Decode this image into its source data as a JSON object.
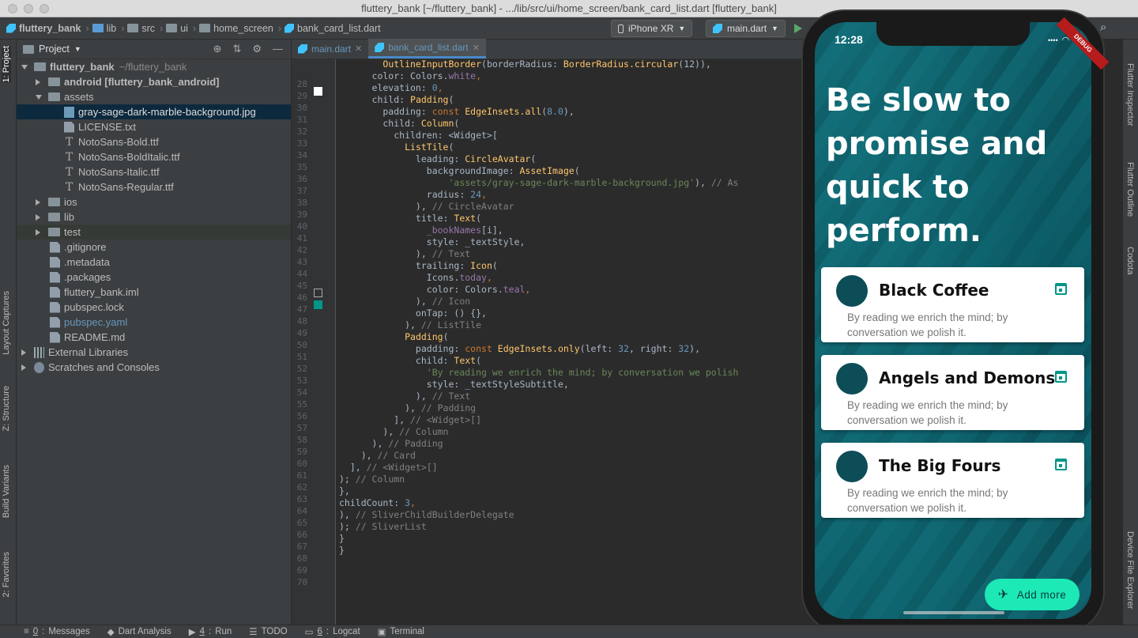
{
  "window": {
    "title": "fluttery_bank [~/fluttery_bank] - .../lib/src/ui/home_screen/bank_card_list.dart [fluttery_bank]"
  },
  "breadcrumbs": [
    "fluttery_bank",
    "lib",
    "src",
    "ui",
    "home_screen",
    "bank_card_list.dart"
  ],
  "toolbar": {
    "device": "iPhone XR",
    "run_config": "main.dart"
  },
  "project_panel": {
    "title": "Project",
    "tree": [
      {
        "label": "fluttery_bank",
        "suffix": "~/fluttery_bank",
        "icon": "folder-icon",
        "indent": 0,
        "arrow": "down",
        "bold": true
      },
      {
        "label": "android [fluttery_bank_android]",
        "icon": "folder-icon",
        "indent": 1,
        "arrow": "right",
        "bold": true
      },
      {
        "label": "assets",
        "icon": "folder-icon",
        "indent": 1,
        "arrow": "down"
      },
      {
        "label": "gray-sage-dark-marble-background.jpg",
        "icon": "image-file-icon",
        "indent": 2,
        "selected": true
      },
      {
        "label": "LICENSE.txt",
        "icon": "text-file-icon",
        "indent": 2
      },
      {
        "label": "NotoSans-Bold.ttf",
        "icon": "font-file-icon",
        "indent": 2
      },
      {
        "label": "NotoSans-BoldItalic.ttf",
        "icon": "font-file-icon",
        "indent": 2
      },
      {
        "label": "NotoSans-Italic.ttf",
        "icon": "font-file-icon",
        "indent": 2
      },
      {
        "label": "NotoSans-Regular.ttf",
        "icon": "font-file-icon",
        "indent": 2
      },
      {
        "label": "ios",
        "icon": "folder-icon",
        "indent": 1,
        "arrow": "right"
      },
      {
        "label": "lib",
        "icon": "folder-icon",
        "indent": 1,
        "arrow": "right"
      },
      {
        "label": "test",
        "icon": "folder-icon",
        "indent": 1,
        "arrow": "right",
        "highlight": true
      },
      {
        "label": ".gitignore",
        "icon": "text-file-icon",
        "indent": 1
      },
      {
        "label": ".metadata",
        "icon": "text-file-icon",
        "indent": 1
      },
      {
        "label": ".packages",
        "icon": "text-file-icon",
        "indent": 1
      },
      {
        "label": "fluttery_bank.iml",
        "icon": "text-file-icon",
        "indent": 1
      },
      {
        "label": "pubspec.lock",
        "icon": "text-file-icon",
        "indent": 1
      },
      {
        "label": "pubspec.yaml",
        "icon": "text-file-icon",
        "indent": 1,
        "blue": true
      },
      {
        "label": "README.md",
        "icon": "text-file-icon",
        "indent": 1
      },
      {
        "label": "External Libraries",
        "icon": "library-icon",
        "indent": 0,
        "arrow": "right"
      },
      {
        "label": "Scratches and Consoles",
        "icon": "scratch-icon",
        "indent": 0,
        "arrow": "right"
      }
    ]
  },
  "editor": {
    "tabs": [
      {
        "label": "main.dart",
        "active": false
      },
      {
        "label": "bank_card_list.dart",
        "active": true
      }
    ],
    "first_line": 28,
    "lines": [
      [
        [
          "        ",
          ""
        ],
        [
          "OutlineInputBorder",
          "#ffc66d"
        ],
        [
          "(borderRadius: ",
          "#a9b7c6"
        ],
        [
          "BorderRadius.circular",
          "#ffc66d"
        ],
        [
          "(12)),",
          "#a9b7c6"
        ]
      ],
      [
        [
          "      color: Colors.",
          "#a9b7c6"
        ],
        [
          "white",
          "#9876aa"
        ],
        [
          ",",
          "#cc7832"
        ]
      ],
      [
        [
          "      elevation: ",
          "#a9b7c6"
        ],
        [
          "0",
          "#6897bb"
        ],
        [
          ",",
          "#cc7832"
        ]
      ],
      [
        [
          "      child: ",
          "#a9b7c6"
        ],
        [
          "Padding",
          "#ffc66d"
        ],
        [
          "(",
          "#a9b7c6"
        ]
      ],
      [
        [
          "        padding: ",
          "#a9b7c6"
        ],
        [
          "const ",
          "#cc7832"
        ],
        [
          "EdgeInsets.all",
          "#ffc66d"
        ],
        [
          "(",
          "#a9b7c6"
        ],
        [
          "8.0",
          "#6897bb"
        ],
        [
          "),",
          "#a9b7c6"
        ]
      ],
      [
        [
          "        child: ",
          "#a9b7c6"
        ],
        [
          "Column",
          "#ffc66d"
        ],
        [
          "(",
          "#a9b7c6"
        ]
      ],
      [
        [
          "          children: <Widget>[",
          "#a9b7c6"
        ]
      ],
      [
        [
          "            ",
          ""
        ],
        [
          "ListTile",
          "#ffc66d"
        ],
        [
          "(",
          "#a9b7c6"
        ]
      ],
      [
        [
          "              leading: ",
          "#a9b7c6"
        ],
        [
          "CircleAvatar",
          "#ffc66d"
        ],
        [
          "(",
          "#a9b7c6"
        ]
      ],
      [
        [
          "                backgroundImage: ",
          "#a9b7c6"
        ],
        [
          "AssetImage",
          "#ffc66d"
        ],
        [
          "(",
          "#a9b7c6"
        ]
      ],
      [
        [
          "                    ",
          ""
        ],
        [
          "'assets/gray-sage-dark-marble-background.jpg'",
          "#6a8759"
        ],
        [
          "), ",
          "#a9b7c6"
        ],
        [
          "// As",
          "#808080"
        ]
      ],
      [
        [
          "                radius: ",
          "#a9b7c6"
        ],
        [
          "24",
          "#6897bb"
        ],
        [
          ",",
          "#cc7832"
        ]
      ],
      [
        [
          "              ), ",
          "#a9b7c6"
        ],
        [
          "// CircleAvatar",
          "#808080"
        ]
      ],
      [
        [
          "              title: ",
          "#a9b7c6"
        ],
        [
          "Text",
          "#ffc66d"
        ],
        [
          "(",
          "#a9b7c6"
        ]
      ],
      [
        [
          "                ",
          ""
        ],
        [
          "_bookNames",
          "#9876aa"
        ],
        [
          "[i],",
          "#a9b7c6"
        ]
      ],
      [
        [
          "                style: _textStyle,",
          "#a9b7c6"
        ]
      ],
      [
        [
          "              ), ",
          "#a9b7c6"
        ],
        [
          "// Text",
          "#808080"
        ]
      ],
      [
        [
          "              trailing: ",
          "#a9b7c6"
        ],
        [
          "Icon",
          "#ffc66d"
        ],
        [
          "(",
          "#a9b7c6"
        ]
      ],
      [
        [
          "                Icons.",
          "#a9b7c6"
        ],
        [
          "today",
          "#9876aa"
        ],
        [
          ",",
          "#cc7832"
        ]
      ],
      [
        [
          "                color: Colors.",
          "#a9b7c6"
        ],
        [
          "teal",
          "#9876aa"
        ],
        [
          ",",
          "#cc7832"
        ]
      ],
      [
        [
          "              ), ",
          "#a9b7c6"
        ],
        [
          "// Icon",
          "#808080"
        ]
      ],
      [
        [
          "              onTap: () {},",
          "#a9b7c6"
        ]
      ],
      [
        [
          "            ), ",
          "#a9b7c6"
        ],
        [
          "// ListTile",
          "#808080"
        ]
      ],
      [
        [
          "            ",
          ""
        ],
        [
          "Padding",
          "#ffc66d"
        ],
        [
          "(",
          "#a9b7c6"
        ]
      ],
      [
        [
          "              padding: ",
          "#a9b7c6"
        ],
        [
          "const ",
          "#cc7832"
        ],
        [
          "EdgeInsets.only",
          "#ffc66d"
        ],
        [
          "(left: ",
          "#a9b7c6"
        ],
        [
          "32",
          "#6897bb"
        ],
        [
          ", right: ",
          "#a9b7c6"
        ],
        [
          "32",
          "#6897bb"
        ],
        [
          "),",
          "#a9b7c6"
        ]
      ],
      [
        [
          "              child: ",
          "#a9b7c6"
        ],
        [
          "Text",
          "#ffc66d"
        ],
        [
          "(",
          "#a9b7c6"
        ]
      ],
      [
        [
          "                ",
          ""
        ],
        [
          "'By reading we enrich the mind; by conversation we polish",
          "#6a8759"
        ]
      ],
      [
        [
          "                style: _textStyleSubtitle,",
          "#a9b7c6"
        ]
      ],
      [
        [
          "              ), ",
          "#a9b7c6"
        ],
        [
          "// Text",
          "#808080"
        ]
      ],
      [
        [
          "            ), ",
          "#a9b7c6"
        ],
        [
          "// Padding",
          "#808080"
        ]
      ],
      [
        [
          "          ], ",
          "#a9b7c6"
        ],
        [
          "// <Widget>[]",
          "#808080"
        ]
      ],
      [
        [
          "        ), ",
          "#a9b7c6"
        ],
        [
          "// Column",
          "#808080"
        ]
      ],
      [
        [
          "      ), ",
          "#a9b7c6"
        ],
        [
          "// Padding",
          "#808080"
        ]
      ],
      [
        [
          "    ), ",
          "#a9b7c6"
        ],
        [
          "// Card",
          "#808080"
        ]
      ],
      [
        [
          "  ], ",
          "#a9b7c6"
        ],
        [
          "// <Widget>[]",
          "#808080"
        ]
      ],
      [
        [
          "); ",
          "#a9b7c6"
        ],
        [
          "// Column",
          "#808080"
        ]
      ],
      [
        [
          "},",
          "#a9b7c6"
        ]
      ],
      [
        [
          "childCount: ",
          "#a9b7c6"
        ],
        [
          "3",
          "#6897bb"
        ],
        [
          ",",
          "#cc7832"
        ]
      ],
      [
        [
          "), ",
          "#a9b7c6"
        ],
        [
          "// SliverChildBuilderDelegate",
          "#808080"
        ]
      ],
      [
        [
          "); ",
          "#a9b7c6"
        ],
        [
          "// SliverList",
          "#808080"
        ]
      ],
      [
        [
          "}",
          "#a9b7c6"
        ]
      ],
      [
        [
          "}",
          "#a9b7c6"
        ]
      ],
      [
        [
          "",
          ""
        ]
      ]
    ]
  },
  "phone": {
    "time": "12:28",
    "debug_banner": "DEBUG",
    "quote": "Be slow to promise and quick to perform.",
    "cards": [
      {
        "title": "Black Coffee",
        "subtitle": "By reading we enrich the mind; by conversation we polish it."
      },
      {
        "title": "Angels and Demons",
        "subtitle": "By reading we enrich the mind; by conversation we polish it."
      },
      {
        "title": "The Big Fours",
        "subtitle": "By reading we enrich the mind; by conversation we polish it."
      }
    ],
    "fab_label": "Add more",
    "colors": {
      "accent": "#1de9b6",
      "icon": "#009688",
      "card_bg": "#ffffff"
    }
  },
  "left_tabs": [
    "1: Project",
    "Layout Captures",
    "Z: Structure",
    "Build Variants",
    "2: Favorites"
  ],
  "right_tabs": [
    "Flutter Inspector",
    "Flutter Outline",
    "Codota",
    "Device File Explorer"
  ],
  "bottom_tabs": [
    {
      "key": "0",
      "label": "Messages"
    },
    {
      "key": "",
      "label": "Dart Analysis"
    },
    {
      "key": "4",
      "label": "Run"
    },
    {
      "key": "",
      "label": "TODO"
    },
    {
      "key": "6",
      "label": "Logcat"
    },
    {
      "key": "",
      "label": "Terminal"
    }
  ]
}
